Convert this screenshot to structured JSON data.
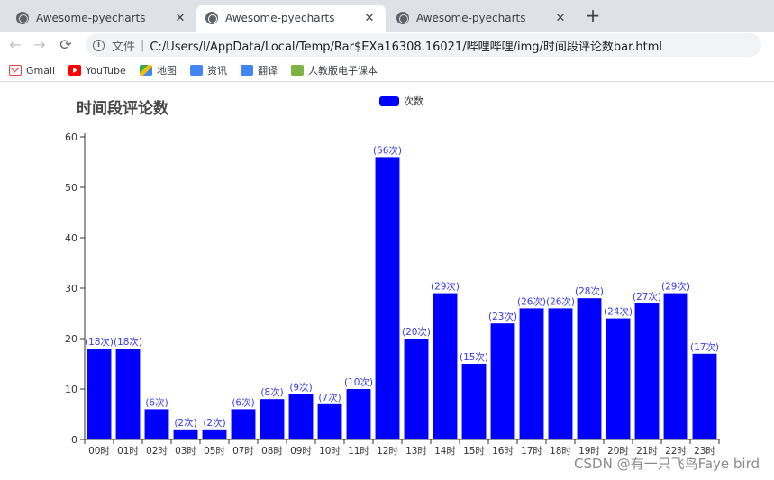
{
  "browser": {
    "tabs": [
      {
        "title": "Awesome-pyecharts",
        "close": "✕",
        "active": false
      },
      {
        "title": "Awesome-pyecharts",
        "close": "✕",
        "active": true
      },
      {
        "title": "Awesome-pyecharts",
        "close": "✕",
        "active": false
      }
    ],
    "new_tab": "+",
    "nav": {
      "back": "←",
      "forward": "→",
      "reload": "⟳"
    },
    "address": {
      "info": "i",
      "scheme_label": "文件",
      "separator": "|",
      "url": "C:/Users/l/AppData/Local/Temp/Rar$EXa16308.16021/哔哩哔哩/img/时间段评论数bar.html"
    },
    "bookmarks": [
      {
        "label": "Gmail",
        "icon": "gmail-icon"
      },
      {
        "label": "YouTube",
        "icon": "youtube-icon"
      },
      {
        "label": "地图",
        "icon": "maps-icon"
      },
      {
        "label": "资讯",
        "icon": "news-icon"
      },
      {
        "label": "翻译",
        "icon": "translate-icon"
      },
      {
        "label": "人教版电子课本",
        "icon": "book-icon"
      }
    ]
  },
  "page": {
    "watermark": "CSDN @有一只飞鸟Faye bird"
  },
  "colors": {
    "bar": "#0000ff",
    "label": "#3a3ae8",
    "axis": "#333333"
  },
  "chart_data": {
    "type": "bar",
    "title": "时间段评论数",
    "legend": [
      "次数"
    ],
    "legend_position": "top-center",
    "categories": [
      "00时",
      "01时",
      "02时",
      "03时",
      "05时",
      "07时",
      "08时",
      "09时",
      "10时",
      "11时",
      "12时",
      "13时",
      "14时",
      "15时",
      "16时",
      "17时",
      "18时",
      "19时",
      "20时",
      "21时",
      "22时",
      "23时"
    ],
    "series": [
      {
        "name": "次数",
        "values": [
          18,
          18,
          6,
          2,
          2,
          6,
          8,
          9,
          7,
          10,
          56,
          20,
          29,
          15,
          23,
          26,
          26,
          28,
          24,
          27,
          29,
          17
        ]
      }
    ],
    "data_labels": [
      "(18次)",
      "(18次)",
      "(6次)",
      "(2次)",
      "(2次)",
      "(6次)",
      "(8次)",
      "(9次)",
      "(7次)",
      "(10次)",
      "(56次)",
      "(20次)",
      "(29次)",
      "(15次)",
      "(23次)",
      "(26次)",
      "(26次)",
      "(28次)",
      "(24次)",
      "(27次)",
      "(29次)",
      "(17次)"
    ],
    "ylim": [
      0,
      60
    ],
    "yticks": [
      0,
      10,
      20,
      30,
      40,
      50,
      60
    ],
    "grid": false
  }
}
